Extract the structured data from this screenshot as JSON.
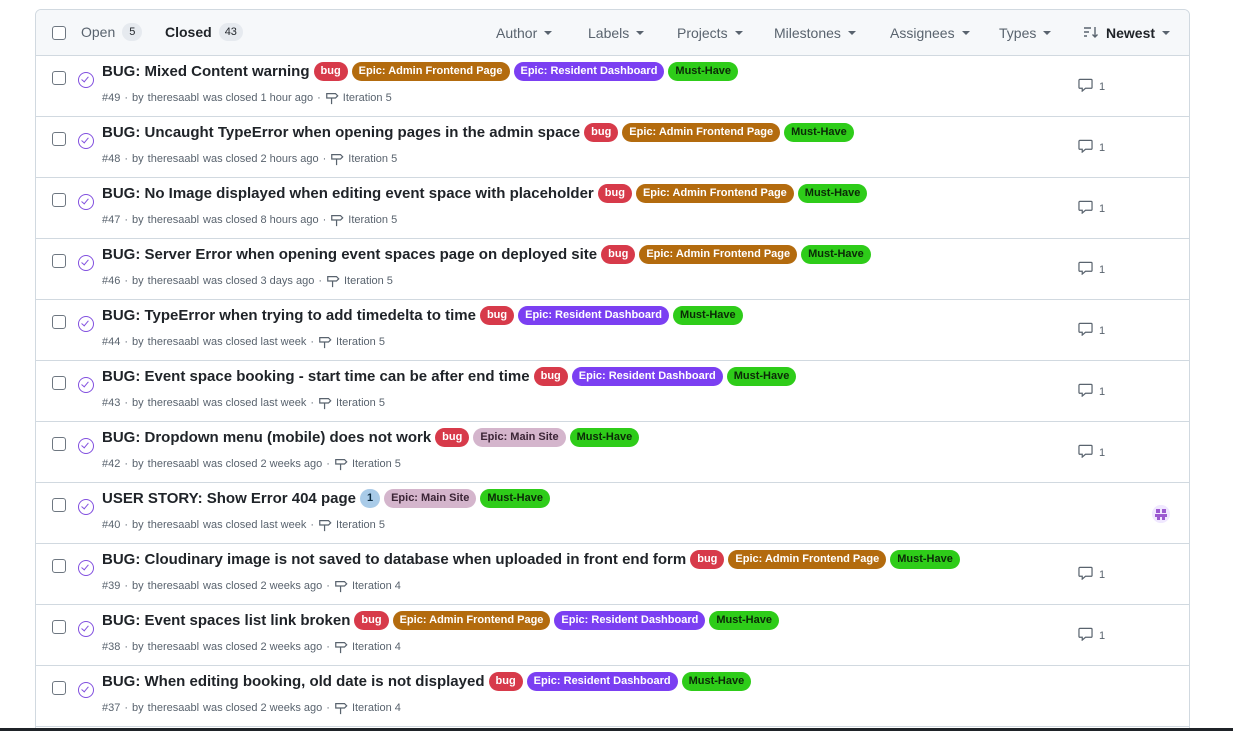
{
  "header": {
    "open_label": "Open",
    "open_count": "5",
    "closed_label": "Closed",
    "closed_count": "43",
    "filters": {
      "author": "Author",
      "labels": "Labels",
      "projects": "Projects",
      "milestones": "Milestones",
      "assignees": "Assignees",
      "types": "Types",
      "sort": "Newest"
    }
  },
  "label_colors": {
    "bug": {
      "bg": "#d73a4a",
      "fg": "#ffffff"
    },
    "Epic: Admin Frontend Page": {
      "bg": "#b36b0e",
      "fg": "#ffffff"
    },
    "Epic: Resident Dashboard": {
      "bg": "#7b3ff2",
      "fg": "#ffffff"
    },
    "Must-Have": {
      "bg": "#2ecc19",
      "fg": "#0b2a07"
    },
    "Epic: Main Site": {
      "bg": "#d4b5cc",
      "fg": "#3a2435"
    },
    "1": {
      "bg": "#a9cbe8",
      "fg": "#0b2a3f"
    }
  },
  "issues": [
    {
      "title": "BUG: Mixed Content warning",
      "labels": [
        "bug",
        "Epic: Admin Frontend Page",
        "Epic: Resident Dashboard",
        "Must-Have"
      ],
      "number": "#49",
      "author": "theresaabl",
      "closed": "was closed 1 hour ago",
      "milestone": "Iteration 5",
      "comments": "1"
    },
    {
      "title": "BUG: Uncaught TypeError when opening pages in the admin space",
      "labels": [
        "bug",
        "Epic: Admin Frontend Page",
        "Must-Have"
      ],
      "number": "#48",
      "author": "theresaabl",
      "closed": "was closed 2 hours ago",
      "milestone": "Iteration 5",
      "comments": "1"
    },
    {
      "title": "BUG: No Image displayed when editing event space with placeholder",
      "labels": [
        "bug",
        "Epic: Admin Frontend Page",
        "Must-Have"
      ],
      "number": "#47",
      "author": "theresaabl",
      "closed": "was closed 8 hours ago",
      "milestone": "Iteration 5",
      "comments": "1"
    },
    {
      "title": "BUG: Server Error when opening event spaces page on deployed site",
      "labels": [
        "bug",
        "Epic: Admin Frontend Page",
        "Must-Have"
      ],
      "number": "#46",
      "author": "theresaabl",
      "closed": "was closed 3 days ago",
      "milestone": "Iteration 5",
      "comments": "1"
    },
    {
      "title": "BUG: TypeError when trying to add timedelta to time",
      "labels": [
        "bug",
        "Epic: Resident Dashboard",
        "Must-Have"
      ],
      "number": "#44",
      "author": "theresaabl",
      "closed": "was closed last week",
      "milestone": "Iteration 5",
      "comments": "1"
    },
    {
      "title": "BUG: Event space booking - start time can be after end time",
      "labels": [
        "bug",
        "Epic: Resident Dashboard",
        "Must-Have"
      ],
      "number": "#43",
      "author": "theresaabl",
      "closed": "was closed last week",
      "milestone": "Iteration 5",
      "comments": "1"
    },
    {
      "title": "BUG: Dropdown menu (mobile) does not work",
      "labels": [
        "bug",
        "Epic: Main Site",
        "Must-Have"
      ],
      "number": "#42",
      "author": "theresaabl",
      "closed": "was closed 2 weeks ago",
      "milestone": "Iteration 5",
      "comments": "1"
    },
    {
      "title": "USER STORY: Show Error 404 page",
      "labels": [
        "1",
        "Epic: Main Site",
        "Must-Have"
      ],
      "number": "#40",
      "author": "theresaabl",
      "closed": "was closed last week",
      "milestone": "Iteration 5",
      "comments": "",
      "assignee_avatar": true
    },
    {
      "title": "BUG: Cloudinary image is not saved to database when uploaded in front end form",
      "labels": [
        "bug",
        "Epic: Admin Frontend Page",
        "Must-Have"
      ],
      "number": "#39",
      "author": "theresaabl",
      "closed": "was closed 2 weeks ago",
      "milestone": "Iteration 4",
      "comments": "1"
    },
    {
      "title": "BUG: Event spaces list link broken",
      "labels": [
        "bug",
        "Epic: Admin Frontend Page",
        "Epic: Resident Dashboard",
        "Must-Have"
      ],
      "number": "#38",
      "author": "theresaabl",
      "closed": "was closed 2 weeks ago",
      "milestone": "Iteration 4",
      "comments": "1"
    },
    {
      "title": "BUG: When editing booking, old date is not displayed",
      "labels": [
        "bug",
        "Epic: Resident Dashboard",
        "Must-Have"
      ],
      "number": "#37",
      "author": "theresaabl",
      "closed": "was closed 2 weeks ago",
      "milestone": "Iteration 4",
      "comments": ""
    }
  ]
}
